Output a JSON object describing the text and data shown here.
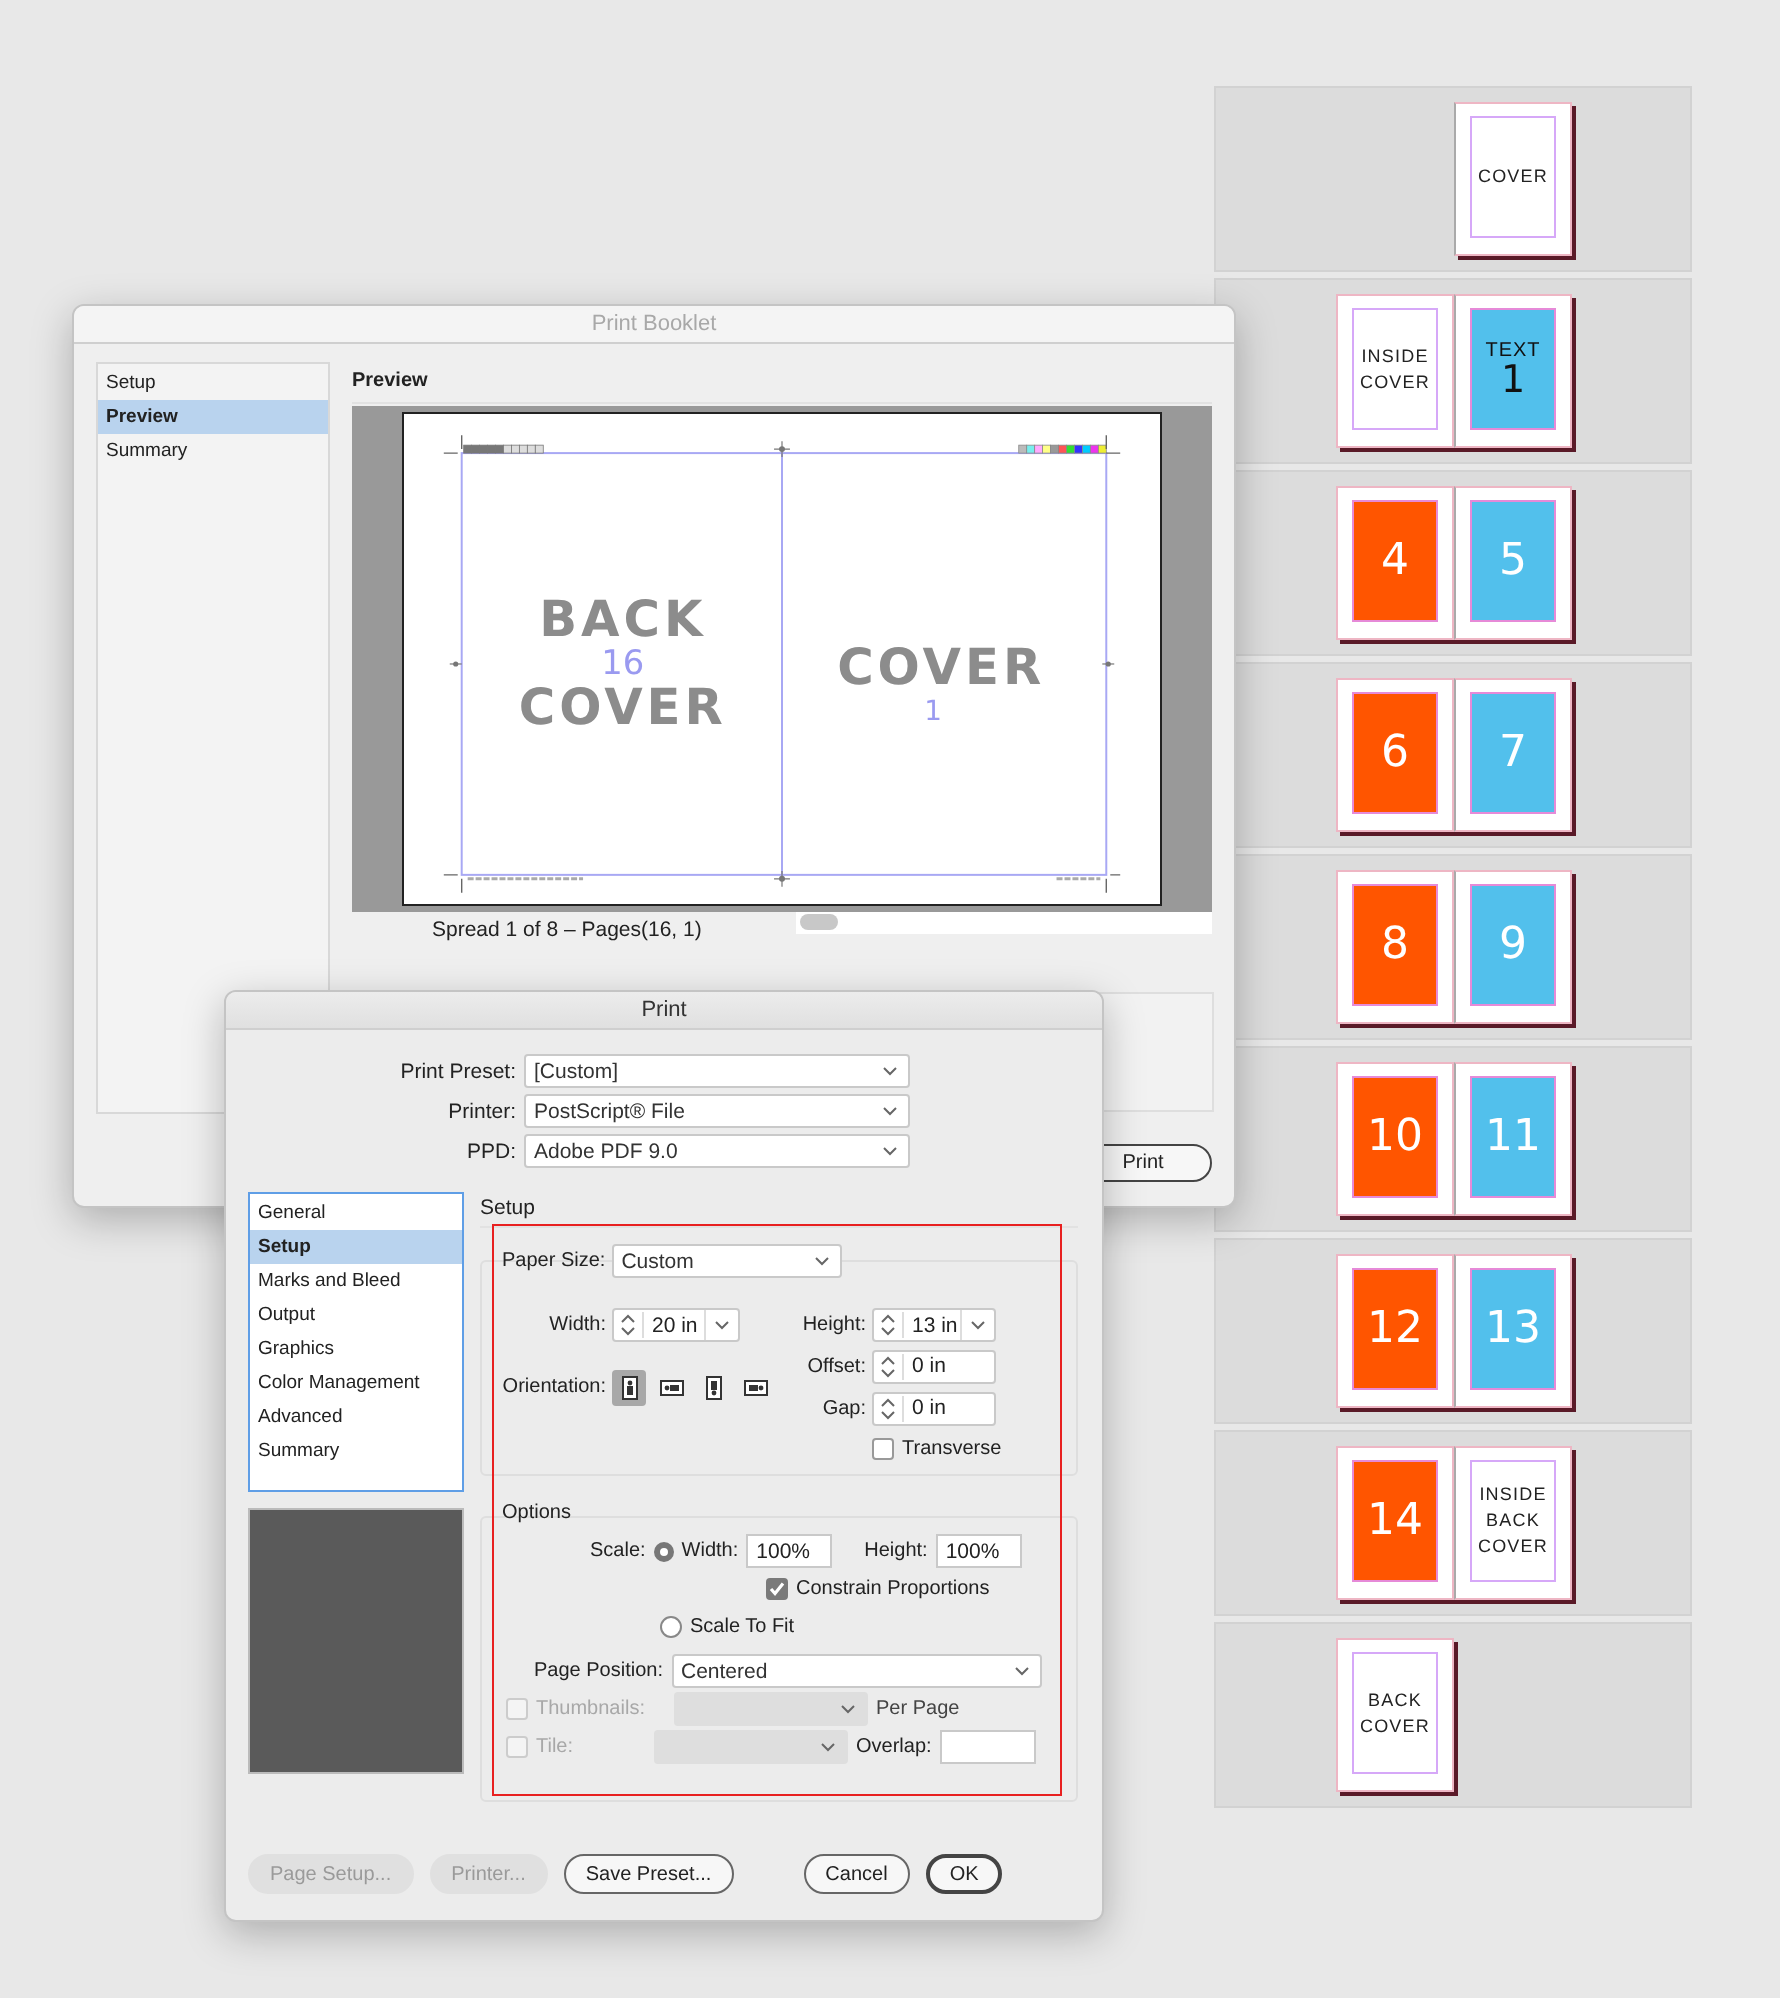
{
  "booklet_window": {
    "title": "Print Booklet",
    "sidebar": [
      {
        "label": "Setup",
        "selected": false
      },
      {
        "label": "Preview",
        "selected": true
      },
      {
        "label": "Summary",
        "selected": false
      }
    ],
    "heading": "Preview",
    "preview": {
      "pages": [
        {
          "title_lines": [
            "BACK",
            "COVER"
          ],
          "number": "16"
        },
        {
          "title_lines": [
            "COVER"
          ],
          "number": "1"
        }
      ]
    },
    "spread_caption": "Spread 1 of 8 – Pages(16, 1)",
    "print_button": "Print"
  },
  "print_dialog": {
    "title": "Print",
    "fields": [
      {
        "label": "Print Preset:",
        "value": "[Custom]"
      },
      {
        "label": "Printer:",
        "value": "PostScript® File"
      },
      {
        "label": "PPD:",
        "value": "Adobe PDF 9.0"
      }
    ],
    "sidebar": [
      {
        "label": "General",
        "selected": false
      },
      {
        "label": "Setup",
        "selected": true
      },
      {
        "label": "Marks and Bleed",
        "selected": false
      },
      {
        "label": "Output",
        "selected": false
      },
      {
        "label": "Graphics",
        "selected": false
      },
      {
        "label": "Color Management",
        "selected": false
      },
      {
        "label": "Advanced",
        "selected": false
      },
      {
        "label": "Summary",
        "selected": false
      }
    ],
    "section": "Setup",
    "paper_size": {
      "label": "Paper Size:",
      "value": "Custom"
    },
    "width": {
      "label": "Width:",
      "value": "20 in"
    },
    "height": {
      "label": "Height:",
      "value": "13 in"
    },
    "orientation": {
      "label": "Orientation:",
      "options": [
        {
          "kind": "portrait",
          "selected": true
        },
        {
          "kind": "landscape",
          "selected": false
        },
        {
          "kind": "reverse-portrait",
          "selected": false
        },
        {
          "kind": "reverse-landscape",
          "selected": false
        }
      ]
    },
    "offset": {
      "label": "Offset:",
      "value": "0 in"
    },
    "gap": {
      "label": "Gap:",
      "value": "0 in"
    },
    "transverse": {
      "label": "Transverse",
      "checked": false
    },
    "options": {
      "heading": "Options",
      "scale_label": "Scale:",
      "scale_width": {
        "label": "Width:",
        "value": "100%",
        "selected": true
      },
      "scale_height": {
        "label": "Height:",
        "value": "100%"
      },
      "constrain": {
        "label": "Constrain Proportions",
        "checked": true
      },
      "scale_to_fit": {
        "label": "Scale To Fit",
        "selected": false
      },
      "page_position": {
        "label": "Page Position:",
        "value": "Centered"
      },
      "thumbnails": {
        "label": "Thumbnails:",
        "suffix": "Per Page",
        "checked": false,
        "disabled": true
      },
      "tile": {
        "label": "Tile:",
        "overlap_label": "Overlap:",
        "checked": false,
        "disabled": true
      }
    },
    "buttons": [
      {
        "label": "Page Setup...",
        "disabled": true,
        "default": false
      },
      {
        "label": "Printer...",
        "disabled": true,
        "default": false
      },
      {
        "label": "Save Preset...",
        "disabled": false,
        "default": false
      },
      {
        "label": "Cancel",
        "disabled": false,
        "default": false
      },
      {
        "label": "OK",
        "disabled": false,
        "default": true
      }
    ]
  },
  "pages_panel": {
    "spreads": [
      {
        "right": {
          "kind": "label",
          "text": "COVER"
        }
      },
      {
        "left": {
          "kind": "label",
          "text": "INSIDE COVER"
        },
        "right": {
          "kind": "titled",
          "text": "TEXT",
          "number": "1",
          "color": "#52c0ec"
        }
      },
      {
        "left": {
          "kind": "number",
          "number": "4",
          "color": "#ff5500"
        },
        "right": {
          "kind": "number",
          "number": "5",
          "color": "#52c0ec"
        }
      },
      {
        "left": {
          "kind": "number",
          "number": "6",
          "color": "#ff5500"
        },
        "right": {
          "kind": "number",
          "number": "7",
          "color": "#52c0ec"
        }
      },
      {
        "left": {
          "kind": "number",
          "number": "8",
          "color": "#ff5500"
        },
        "right": {
          "kind": "number",
          "number": "9",
          "color": "#52c0ec"
        }
      },
      {
        "left": {
          "kind": "number",
          "number": "10",
          "color": "#ff5500"
        },
        "right": {
          "kind": "number",
          "number": "11",
          "color": "#52c0ec"
        }
      },
      {
        "left": {
          "kind": "number",
          "number": "12",
          "color": "#ff5500"
        },
        "right": {
          "kind": "number",
          "number": "13",
          "color": "#52c0ec"
        }
      },
      {
        "left": {
          "kind": "number",
          "number": "14",
          "color": "#ff5500"
        },
        "right": {
          "kind": "label",
          "text": "INSIDE BACK COVER"
        }
      },
      {
        "left": {
          "kind": "label",
          "text": "BACK COVER"
        }
      }
    ]
  }
}
